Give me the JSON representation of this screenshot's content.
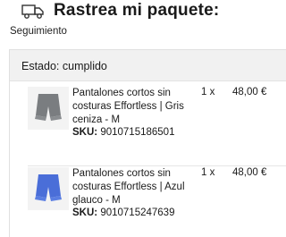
{
  "header": {
    "title": "Rastrea mi paquete:",
    "icon": "truck-icon"
  },
  "tracking_label": "Seguimiento",
  "order": {
    "status": "Estado: cumplido",
    "items": [
      {
        "name": "Pantalones cortos sin costuras Effortless | Gris ceniza - M",
        "sku_label": "SKU:",
        "sku": "9010715186501",
        "qty": "1 x",
        "price": "48,00 €",
        "color": "#7a7d80"
      },
      {
        "name": "Pantalones cortos sin costuras Effortless | Azul glauco - M",
        "sku_label": "SKU:",
        "sku": "9010715247639",
        "qty": "1 x",
        "price": "48,00 €",
        "color": "#4a6ed8"
      }
    ]
  }
}
